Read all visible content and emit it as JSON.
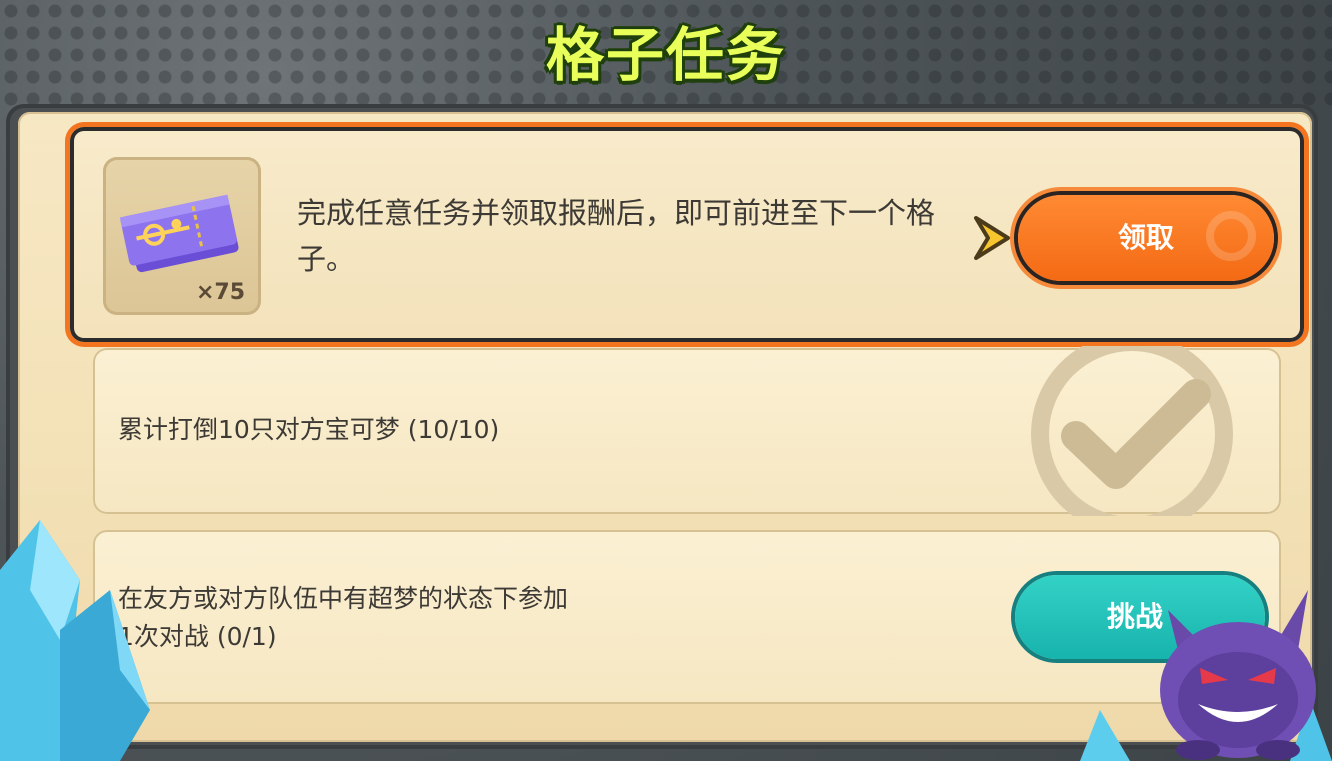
{
  "header": {
    "title": "格子任务"
  },
  "tasks": [
    {
      "text": "完成任意任务并领取报酬后，即可前进至下一个格子。",
      "reward": {
        "icon": "ticket-icon",
        "count": "×75"
      },
      "button_label": "领取"
    },
    {
      "text": "累计打倒10只对方宝可梦 (10/10)",
      "status_icon": "checkmark-icon"
    },
    {
      "text_line1": "在友方或对方队伍中有超梦的状态下参加",
      "text_line2": "1次对战 (0/1)",
      "button_label": "挑战"
    }
  ],
  "colors": {
    "title": "#e9ff5a",
    "accent_orange": "#f46a14",
    "accent_teal": "#17b3ad",
    "panel_beige": "#f3e1b7"
  }
}
